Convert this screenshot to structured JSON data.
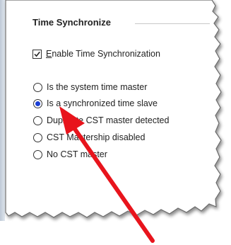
{
  "group": {
    "title": "Time Synchronize"
  },
  "checkbox": {
    "label_mnemonic": "E",
    "label_rest": "nable Time Synchronization",
    "checked": true
  },
  "radios": [
    {
      "label": "Is the system time master",
      "selected": false
    },
    {
      "label": "Is a synchronized time slave",
      "selected": true
    },
    {
      "label": "Duplicate CST master detected",
      "selected": false
    },
    {
      "label": "CST Mastership disabled",
      "selected": false
    },
    {
      "label": "No CST master",
      "selected": false
    }
  ],
  "colors": {
    "radio_dot": "#1a3fd4",
    "annotation_arrow": "#e8141c"
  },
  "annotation": {
    "type": "arrow",
    "points_to": "radio-is-a-synchronized-time-slave"
  }
}
